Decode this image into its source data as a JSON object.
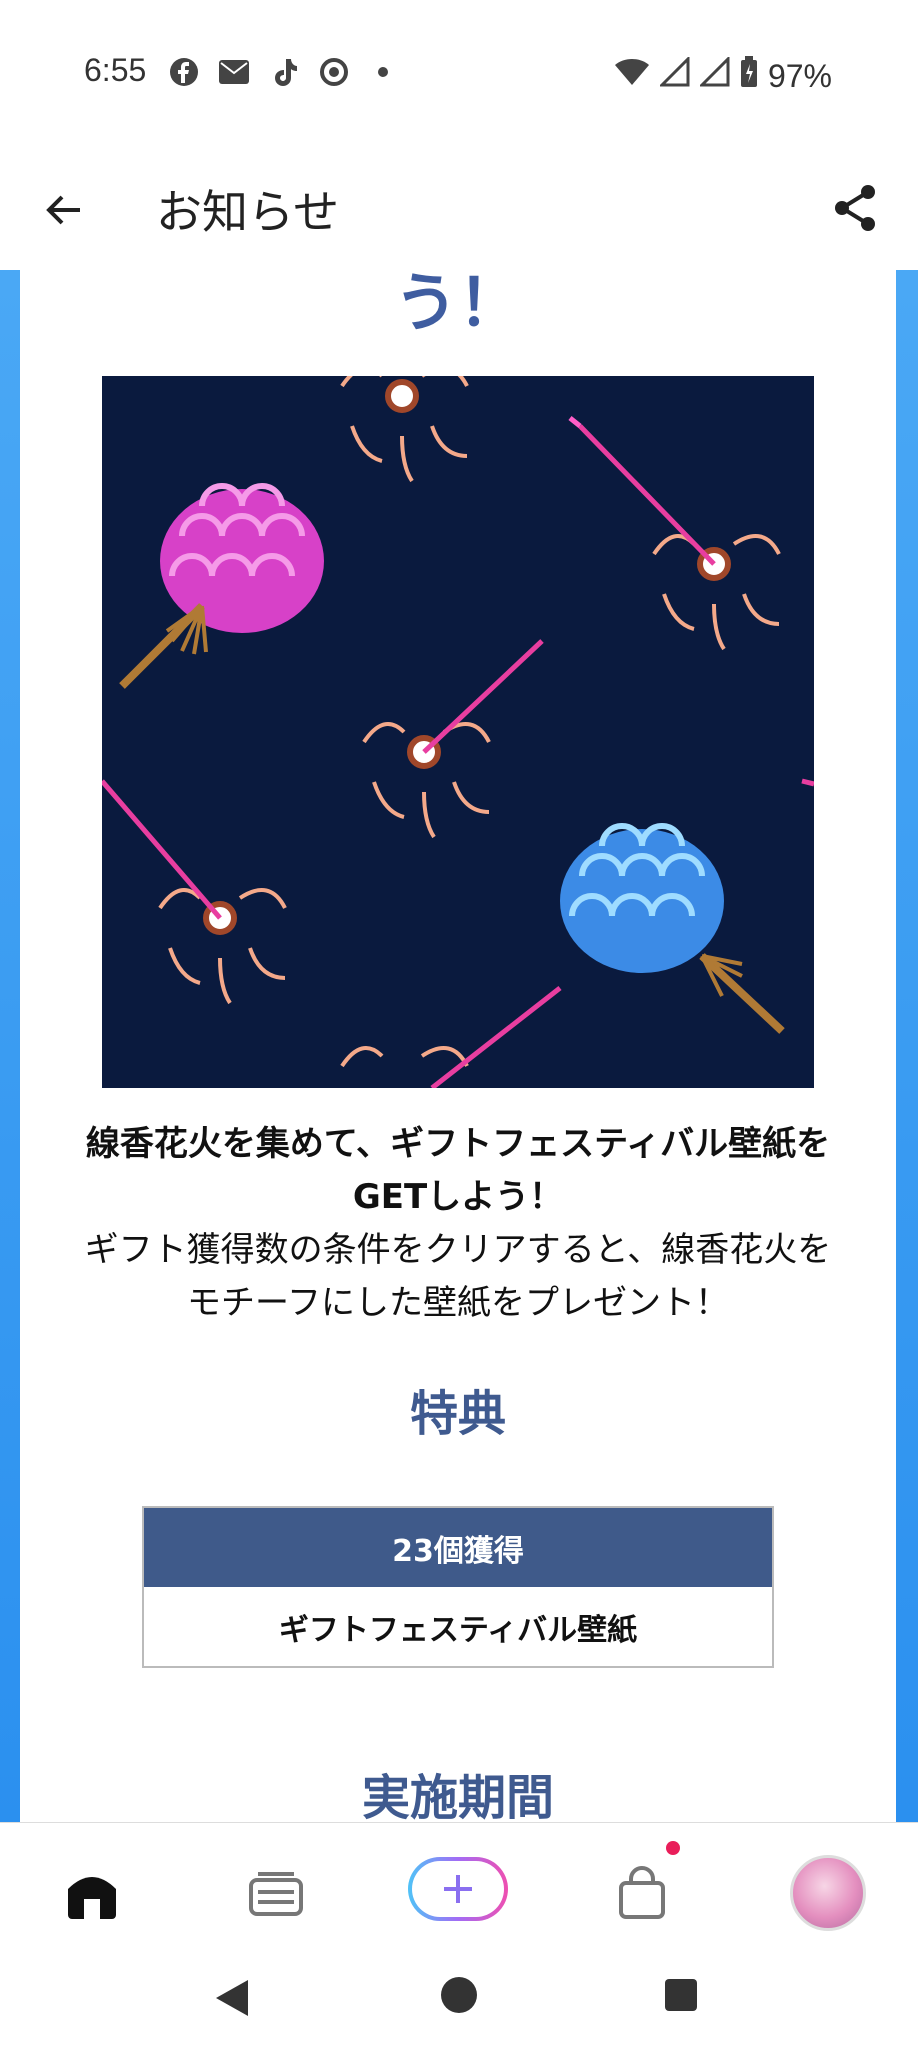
{
  "status_bar": {
    "time": "6:55",
    "battery": "97%",
    "icons_left": [
      "facebook-icon",
      "mail-icon",
      "tiktok-icon",
      "app-icon"
    ],
    "icons_right": [
      "wifi-icon",
      "signal-icon",
      "signal-icon",
      "battery-icon"
    ]
  },
  "header": {
    "title": "お知らせ"
  },
  "article": {
    "partial_heading": "う！",
    "lead_bold_line1": "線香花火を集めて、ギフトフェスティバル壁紙を",
    "lead_bold_line2": "GETしよう！",
    "lead_line3": "ギフト獲得数の条件をクリアすると、線香花火を",
    "lead_line4": "モチーフにした壁紙をプレゼント！",
    "section_bonus": "特典",
    "bonus_table": {
      "header": "23個獲得",
      "reward": "ギフトフェスティバル壁紙"
    },
    "section_period": "実施期間"
  },
  "colors": {
    "accent_blue": "#3f5a8f",
    "side_blue": "#2b90ef",
    "hero_bg": "#0a1a3e"
  },
  "bottom_nav": {
    "items": [
      "home-icon",
      "list-icon",
      "plus-icon",
      "shop-icon",
      "avatar"
    ]
  }
}
